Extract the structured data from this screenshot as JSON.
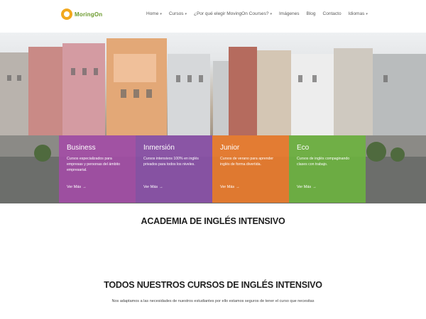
{
  "header": {
    "logo_text": "MoringOn",
    "nav": [
      {
        "label": "Home",
        "has_dropdown": true
      },
      {
        "label": "Cursos",
        "has_dropdown": true
      },
      {
        "label": "¿Por qué elegir MovingOn Courses?",
        "has_dropdown": true
      },
      {
        "label": "Imágenes",
        "has_dropdown": false
      },
      {
        "label": "Blog",
        "has_dropdown": false
      },
      {
        "label": "Contacto",
        "has_dropdown": false
      },
      {
        "label": "Idiomas",
        "has_dropdown": true
      }
    ]
  },
  "cards": [
    {
      "title": "Business",
      "desc": "Cursos especializados para empresas y personas del ámbito empresarial.",
      "more": "Ver Más",
      "color": "#a34ba6"
    },
    {
      "title": "Inmersión",
      "desc": "Cursos intensivos 100% en inglés privados para todos los niveles.",
      "more": "Ver Más",
      "color": "#8a4fa8"
    },
    {
      "title": "Junior",
      "desc": "Cursos de verano para aprender inglés de forma divertida.",
      "more": "Ver Más",
      "color": "#ec7a2a"
    },
    {
      "title": "Eco",
      "desc": "Cursos de inglés compaginando clases con trabajo.",
      "more": "Ver Más",
      "color": "#6db33f"
    }
  ],
  "main": {
    "heading_academy": "ACADEMIA DE INGLÉS INTENSIVO",
    "heading_courses": "TODOS NUESTROS CURSOS DE INGLÉS INTENSIVO",
    "subtext": "Nos adaptamos a las necesidades de nuestros estudiantes por ello estamos seguros de tener el curso que necesitas"
  },
  "colors": {
    "accent_orange": "#f2a81d",
    "logo_green": "#6b9a2c"
  }
}
